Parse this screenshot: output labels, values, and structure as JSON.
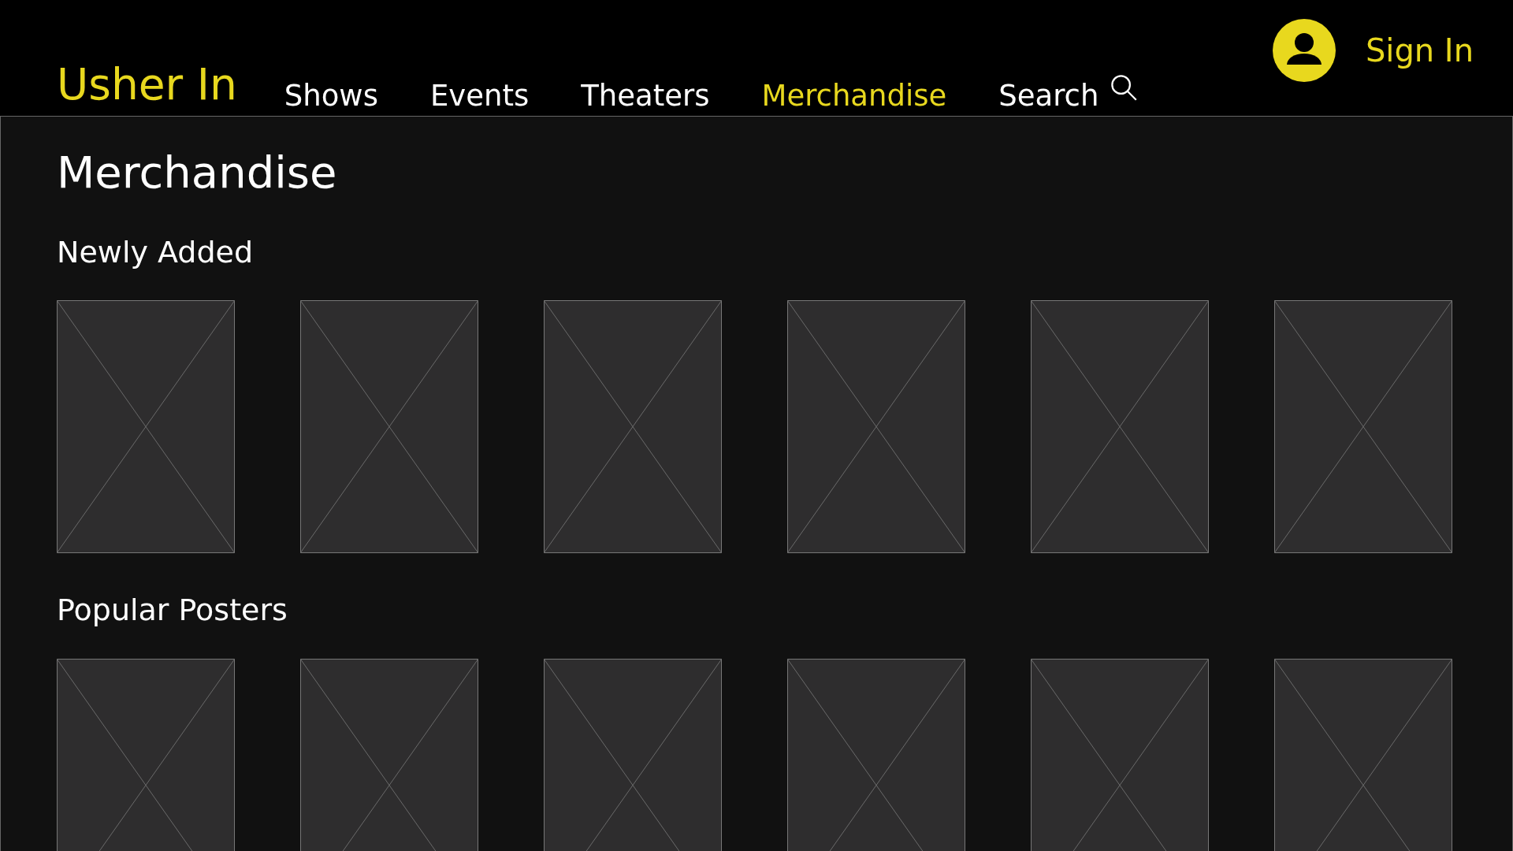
{
  "header": {
    "logo": "Usher In",
    "nav": [
      {
        "label": "Shows",
        "selected": false
      },
      {
        "label": "Events",
        "selected": false
      },
      {
        "label": "Theaters",
        "selected": false
      },
      {
        "label": "Merchandise",
        "selected": true
      }
    ],
    "search": {
      "label": "Search"
    },
    "sign_in": "Sign In"
  },
  "page_title": "Merchandise",
  "sections": [
    {
      "title": "Newly Added",
      "items": [
        {
          "kind": "image"
        },
        {
          "kind": "image"
        },
        {
          "kind": "image"
        },
        {
          "kind": "image"
        },
        {
          "kind": "image"
        },
        {
          "kind": "image"
        }
      ]
    },
    {
      "title": "Popular Posters",
      "items": [
        {
          "kind": "image"
        },
        {
          "kind": "image"
        },
        {
          "kind": "image"
        },
        {
          "kind": "image"
        },
        {
          "kind": "image"
        },
        {
          "kind": "image"
        }
      ]
    }
  ]
}
